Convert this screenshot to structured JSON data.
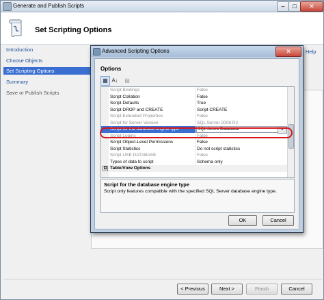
{
  "window": {
    "title": "Generate and Publish Scripts",
    "min_glyph": "–",
    "max_glyph": "□",
    "close_glyph": "✕"
  },
  "header": {
    "page_title": "Set Scripting Options",
    "icon": "scroll-icon"
  },
  "nav": {
    "items": [
      {
        "label": "Introduction"
      },
      {
        "label": "Choose Objects"
      },
      {
        "label": "Set Scripting Options"
      },
      {
        "label": "Summary"
      },
      {
        "label": "Save or Publish Scripts"
      }
    ]
  },
  "help_link": "Help",
  "buttons": {
    "previous": "< Previous",
    "next": "Next >",
    "finish": "Finish",
    "cancel": "Cancel"
  },
  "dialog": {
    "title": "Advanced Scripting Options",
    "close_glyph": "✕",
    "section_label": "Options",
    "toolbar": {
      "categorized_glyph": "▦",
      "alpha_glyph": "A↓",
      "pages_glyph": "▤"
    },
    "rows": [
      {
        "name": "Script Bindings",
        "value": "False"
      },
      {
        "name": "Script Collation",
        "value": "False"
      },
      {
        "name": "Script Defaults",
        "value": "True"
      },
      {
        "name": "Script DROP and CREATE",
        "value": "Script CREATE"
      },
      {
        "name": "Script Extended Properties",
        "value": "False"
      },
      {
        "name": "Script for Server Version",
        "value": "SQL Server 2008 R2"
      },
      {
        "name": "Script for the database engine type",
        "value": "SQL Azure Database"
      },
      {
        "name": "Script Logins",
        "value": "False"
      },
      {
        "name": "Script Object-Level Permissions",
        "value": "False"
      },
      {
        "name": "Script Statistics",
        "value": "Do not script statistics"
      },
      {
        "name": "Script USE DATABASE",
        "value": "False"
      },
      {
        "name": "Types of data to script",
        "value": "Schema only"
      }
    ],
    "category": {
      "expander": "⊟",
      "label": "Table/View Options"
    },
    "dropdown_glyph": "▼",
    "description": {
      "title": "Script for the database engine type",
      "text": "Script only features compatible with the specified SQL Server database engine type."
    },
    "ok": "OK",
    "cancel": "Cancel"
  },
  "colors": {
    "selection": "#3a6fd1",
    "highlight_outline": "#d4161c",
    "link": "#1a4f9c"
  }
}
